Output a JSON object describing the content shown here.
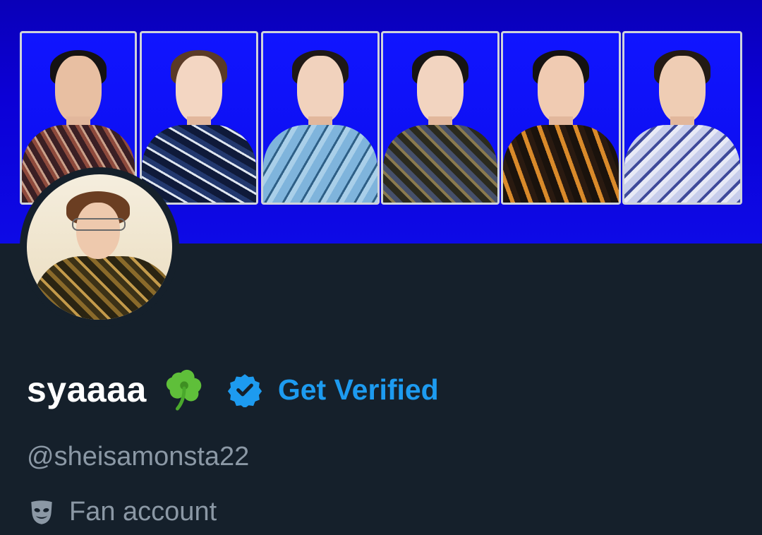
{
  "profile": {
    "display_name": "syaaaa",
    "name_emoji": "four-leaf-clover-icon",
    "get_verified_label": "Get Verified",
    "handle": "@sheisamonsta22",
    "category_icon": "theater-masks-icon",
    "category_label": "Fan account"
  },
  "colors": {
    "background": "#15202b",
    "banner_blue": "#0c00d6",
    "accent": "#1d9bf0",
    "secondary_text": "#8b98a5",
    "primary_text": "#ffffff"
  }
}
